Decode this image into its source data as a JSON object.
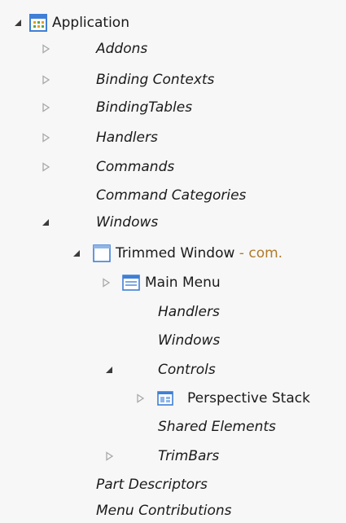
{
  "tree": {
    "application": {
      "label": "Application"
    },
    "addons": {
      "label": "Addons"
    },
    "binding_contexts": {
      "label": "Binding Contexts"
    },
    "binding_tables": {
      "label": "BindingTables"
    },
    "handlers": {
      "label": "Handlers"
    },
    "commands": {
      "label": "Commands"
    },
    "command_categories": {
      "label": "Command Categories"
    },
    "windows": {
      "label": "Windows"
    },
    "trimmed_window": {
      "label": "Trimmed Window",
      "suffix": " - com."
    },
    "main_menu": {
      "label": "Main Menu"
    },
    "tw_handlers": {
      "label": "Handlers"
    },
    "tw_windows": {
      "label": "Windows"
    },
    "controls": {
      "label": "Controls"
    },
    "perspective_stack": {
      "label": "Perspective Stack"
    },
    "shared_elements": {
      "label": "Shared Elements"
    },
    "trimbars": {
      "label": "TrimBars"
    },
    "part_descriptors": {
      "label": "Part Descriptors"
    },
    "menu_contributions": {
      "label": "Menu Contributions"
    }
  },
  "icons": {
    "expanded": "triangle-expanded-icon",
    "collapsed": "triangle-collapsed-icon",
    "application": "application-grid-icon",
    "window": "window-icon",
    "menu": "menu-icon",
    "perspective_stack": "perspective-stack-icon"
  },
  "colors": {
    "background": "#f7f7f7",
    "text": "#1a1a1a",
    "suffix": "#b07a2a",
    "triangle_outline": "#a8a8a8",
    "triangle_filled": "#3b3b3b",
    "icon_blue": "#3f7fd6"
  }
}
